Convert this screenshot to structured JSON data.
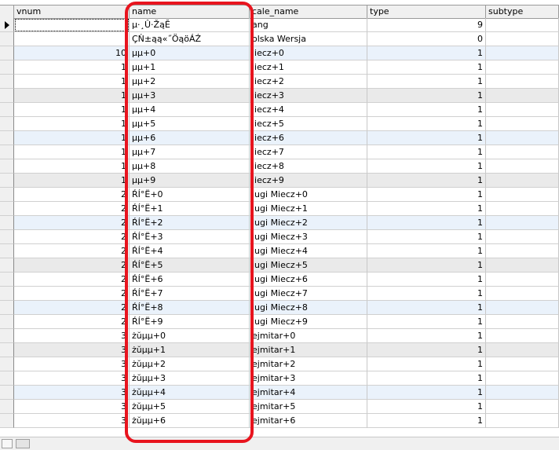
{
  "columns": {
    "vnum": "vnum",
    "name": "name",
    "locale_name": "cale_name",
    "type": "type",
    "subtype": "subtype"
  },
  "rows": [
    {
      "vnum": "",
      "name": "µ·¸Û·ŽąĔ",
      "locale_name": "ang",
      "type": "9"
    },
    {
      "vnum": "",
      "name": "ÇŃ±ąą«˝ÖąöÁŹ",
      "locale_name": "olska Wersja",
      "type": "0"
    },
    {
      "vnum": "10",
      "name": "µµ+0",
      "locale_name": "liecz+0",
      "type": "1"
    },
    {
      "vnum": "1",
      "name": "µµ+1",
      "locale_name": "liecz+1",
      "type": "1"
    },
    {
      "vnum": "1",
      "name": "µµ+2",
      "locale_name": "liecz+2",
      "type": "1"
    },
    {
      "vnum": "1",
      "name": "µµ+3",
      "locale_name": "liecz+3",
      "type": "1"
    },
    {
      "vnum": "1",
      "name": "µµ+4",
      "locale_name": "liecz+4",
      "type": "1"
    },
    {
      "vnum": "1",
      "name": "µµ+5",
      "locale_name": "liecz+5",
      "type": "1"
    },
    {
      "vnum": "1",
      "name": "µµ+6",
      "locale_name": "liecz+6",
      "type": "1"
    },
    {
      "vnum": "1",
      "name": "µµ+7",
      "locale_name": "liecz+7",
      "type": "1"
    },
    {
      "vnum": "1",
      "name": "µµ+8",
      "locale_name": "liecz+8",
      "type": "1"
    },
    {
      "vnum": "1",
      "name": "µµ+9",
      "locale_name": "liecz+9",
      "type": "1"
    },
    {
      "vnum": "2",
      "name": "ŔÍ°Ë+0",
      "locale_name": "lugi Miecz+0",
      "type": "1"
    },
    {
      "vnum": "2",
      "name": "ŔÍ°Ë+1",
      "locale_name": "lugi Miecz+1",
      "type": "1"
    },
    {
      "vnum": "2",
      "name": "ŔÍ°Ë+2",
      "locale_name": "lugi Miecz+2",
      "type": "1"
    },
    {
      "vnum": "2",
      "name": "ŔÍ°Ë+3",
      "locale_name": "lugi Miecz+3",
      "type": "1"
    },
    {
      "vnum": "2",
      "name": "ŔÍ°Ë+4",
      "locale_name": "lugi Miecz+4",
      "type": "1"
    },
    {
      "vnum": "2",
      "name": "ŔÍ°Ë+5",
      "locale_name": "lugi Miecz+5",
      "type": "1"
    },
    {
      "vnum": "2",
      "name": "ŔÍ°Ë+6",
      "locale_name": "lugi Miecz+6",
      "type": "1"
    },
    {
      "vnum": "2",
      "name": "ŔÍ°Ë+7",
      "locale_name": "lugi Miecz+7",
      "type": "1"
    },
    {
      "vnum": "2",
      "name": "ŔÍ°Ë+8",
      "locale_name": "lugi Miecz+8",
      "type": "1"
    },
    {
      "vnum": "2",
      "name": "ŔÍ°Ë+9",
      "locale_name": "lugi Miecz+9",
      "type": "1"
    },
    {
      "vnum": "3",
      "name": "żŭµµ+0",
      "locale_name": "ejmitar+0",
      "type": "1"
    },
    {
      "vnum": "3",
      "name": "żŭµµ+1",
      "locale_name": "ejmitar+1",
      "type": "1"
    },
    {
      "vnum": "3",
      "name": "żŭµµ+2",
      "locale_name": "ejmitar+2",
      "type": "1"
    },
    {
      "vnum": "3",
      "name": "żŭµµ+3",
      "locale_name": "ejmitar+3",
      "type": "1"
    },
    {
      "vnum": "3",
      "name": "żŭµµ+4",
      "locale_name": "ejmitar+4",
      "type": "1"
    },
    {
      "vnum": "3",
      "name": "żŭµµ+5",
      "locale_name": "ejmitar+5",
      "type": "1"
    },
    {
      "vnum": "3",
      "name": "żŭµµ+6",
      "locale_name": "ejmitar+6",
      "type": "1"
    }
  ],
  "current_row_indicator_icon": "arrow-right-icon",
  "highlight_color": "#e8141e"
}
